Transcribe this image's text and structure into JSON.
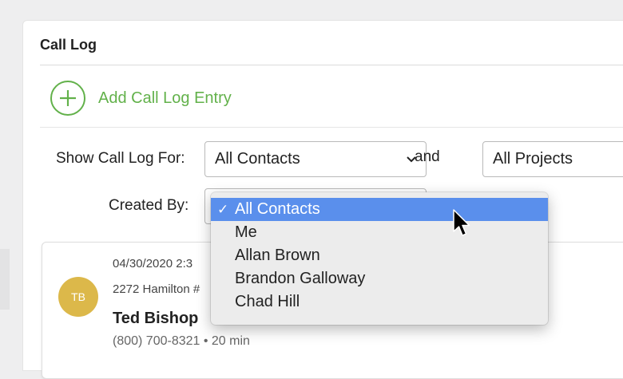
{
  "panel": {
    "title": "Call Log"
  },
  "actions": {
    "add_label": "Add Call Log Entry"
  },
  "filters": {
    "show_for_label": "Show Call Log For:",
    "contacts_value": "All Contacts",
    "and_label": "and",
    "projects_value": "All Projects",
    "created_by_label": "Created By:"
  },
  "dropdown": {
    "options": [
      "All Contacts",
      "Me",
      "Allan Brown",
      "Brandon Galloway",
      "Chad Hill"
    ],
    "selected_index": 0,
    "check_glyph": "✓"
  },
  "entry": {
    "initials": "TB",
    "date": "04/30/2020 2:3",
    "address": "2272 Hamilton #",
    "name": "Ted Bishop",
    "meta": "(800) 700-8321 • 20 min"
  },
  "colors": {
    "accent_green": "#62b14a",
    "selection_blue": "#5a8fec",
    "avatar_gold": "#dcb84a"
  },
  "icons": [
    "plus-icon",
    "chevron-down-icon",
    "checkmark-icon",
    "mouse-pointer-icon"
  ]
}
